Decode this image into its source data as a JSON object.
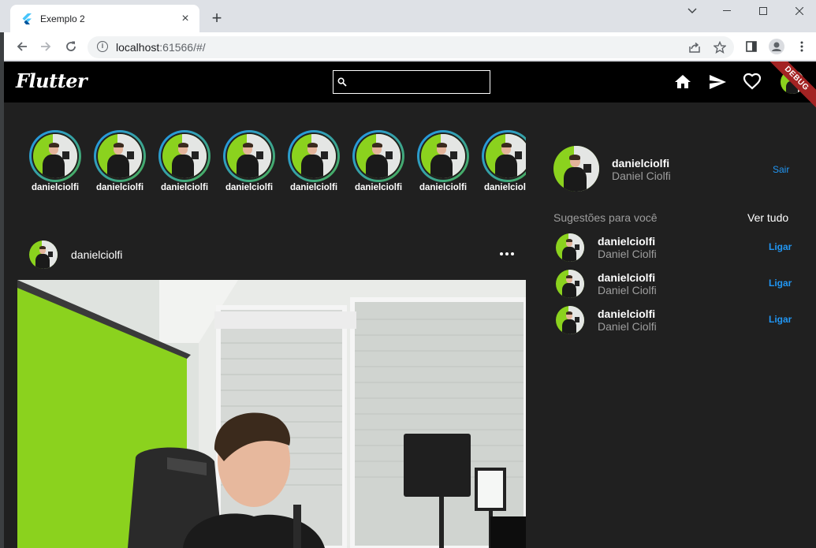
{
  "browser": {
    "tab_title": "Exemplo 2",
    "url_host": "localhost",
    "url_rest": ":61566/#/",
    "new_tab_symbol": "+",
    "close_symbol": "×"
  },
  "app": {
    "logo": "Flutter",
    "search_value": "",
    "debug_label": "DEBUG",
    "icons": [
      "home-icon",
      "send-icon",
      "heart-icon"
    ]
  },
  "stories": [
    {
      "username": "danielciolfi"
    },
    {
      "username": "danielciolfi"
    },
    {
      "username": "danielciolfi"
    },
    {
      "username": "danielciolfi"
    },
    {
      "username": "danielciolfi"
    },
    {
      "username": "danielciolfi"
    },
    {
      "username": "danielciolfi"
    },
    {
      "username": "danielciolfi"
    }
  ],
  "post": {
    "username": "danielciolfi"
  },
  "sidebar": {
    "username": "danielciolfi",
    "full_name": "Daniel Ciolfi",
    "logout_label": "Sair",
    "suggestions_title": "Sugestões para você",
    "see_all_label": "Ver tudo",
    "suggestions": [
      {
        "username": "danielciolfi",
        "full_name": "Daniel Ciolfi",
        "action": "Ligar"
      },
      {
        "username": "danielciolfi",
        "full_name": "Daniel Ciolfi",
        "action": "Ligar"
      },
      {
        "username": "danielciolfi",
        "full_name": "Daniel Ciolfi",
        "action": "Ligar"
      }
    ]
  },
  "colors": {
    "accent": "#2196f3",
    "appbar": "#000000",
    "background": "#202020",
    "story_ring_start": "#2196f3",
    "story_ring_end": "#4caf50",
    "green_screen": "#8bd21e",
    "debug_banner": "#a32323"
  }
}
